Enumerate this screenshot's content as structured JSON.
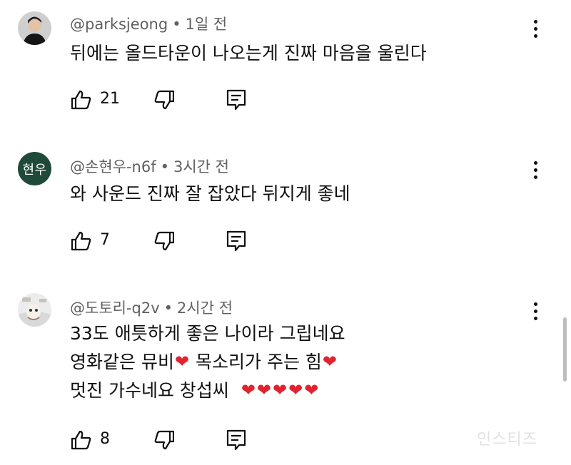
{
  "comments": [
    {
      "author": "@parksjeong",
      "time": "1일 전",
      "lines": [
        "뒤에는 올드타운이 나오는게 진짜 마음을 울린다"
      ],
      "likes": "21",
      "avatar": {
        "type": "photo"
      }
    },
    {
      "author": "@손현우-n6f",
      "time": "3시간 전",
      "lines": [
        "와 사운드 진짜 잘 잡았다 뒤지게 좋네"
      ],
      "likes": "7",
      "avatar": {
        "type": "text",
        "text": "현우",
        "color": "#1f4a39"
      }
    },
    {
      "author": "@도토리-q2v",
      "time": "2시간 전",
      "lines": [
        "33도 애틋하게 좋은 나이라 그립네요",
        "영화같은 뮤비",
        "목소리가 주는 힘",
        "멋진 가수네요 창섭씨"
      ],
      "likes": "8",
      "avatar": {
        "type": "photo"
      }
    }
  ],
  "separator": "•",
  "heart": "❤",
  "icons": {
    "like": "thumbs-up-icon",
    "dislike": "thumbs-down-icon",
    "reply": "reply-icon",
    "more": "more-vertical-icon"
  },
  "watermark": "인스티즈",
  "colors": {
    "meta": "#606060",
    "heart": "#e0242f",
    "avatar_bg": "#1f4a39"
  }
}
